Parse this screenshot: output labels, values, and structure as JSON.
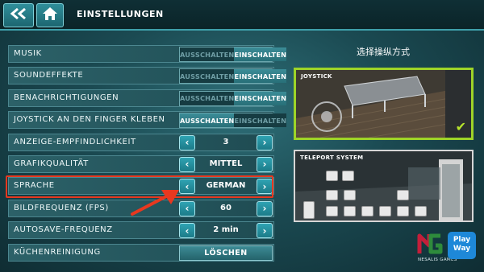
{
  "header": {
    "title": "EINSTELLUNGEN"
  },
  "settings": [
    {
      "label": "MUSIK",
      "type": "toggle",
      "off_label": "AUSSCHALTEN",
      "on_label": "EINSCHALTEN",
      "selected": "on"
    },
    {
      "label": "SOUNDEFFEKTE",
      "type": "toggle",
      "off_label": "AUSSCHALTEN",
      "on_label": "EINSCHALTEN",
      "selected": "on"
    },
    {
      "label": "BENACHRICHTIGUNGEN",
      "type": "toggle",
      "off_label": "AUSSCHALTEN",
      "on_label": "EINSCHALTEN",
      "selected": "on"
    },
    {
      "label": "JOYSTICK AN DEN FINGER KLEBEN",
      "type": "toggle",
      "off_label": "AUSSCHALTEN",
      "on_label": "EINSCHALTEN",
      "selected": "off"
    },
    {
      "label": "ANZEIGE-EMPFINDLICHKEIT",
      "type": "stepper",
      "value": "3"
    },
    {
      "label": "GRAFIKQUALITÄT",
      "type": "stepper",
      "value": "MITTEL"
    },
    {
      "label": "SPRACHE",
      "type": "stepper",
      "value": "GERMAN"
    },
    {
      "label": "BILDFREQUENZ (FPS)",
      "type": "stepper",
      "value": "60"
    },
    {
      "label": "AUTOSAVE-FREQUENZ",
      "type": "stepper",
      "value": "2 min"
    },
    {
      "label": "KÜCHENREINIGUNG",
      "type": "button",
      "value": "LÖSCHEN"
    }
  ],
  "control_mode": {
    "title": "选择操纵方式",
    "options": [
      {
        "label": "JOYSTICK",
        "selected": true
      },
      {
        "label": "TELEPORT SYSTEM",
        "selected": false
      }
    ]
  },
  "logos": {
    "nesalis": "NESALIS GAMES",
    "playway_line1": "Play",
    "playway_line2": "Way"
  },
  "colors": {
    "accent": "#2fa3b3",
    "highlight": "#e8381f",
    "selected_border": "#9ed428"
  }
}
